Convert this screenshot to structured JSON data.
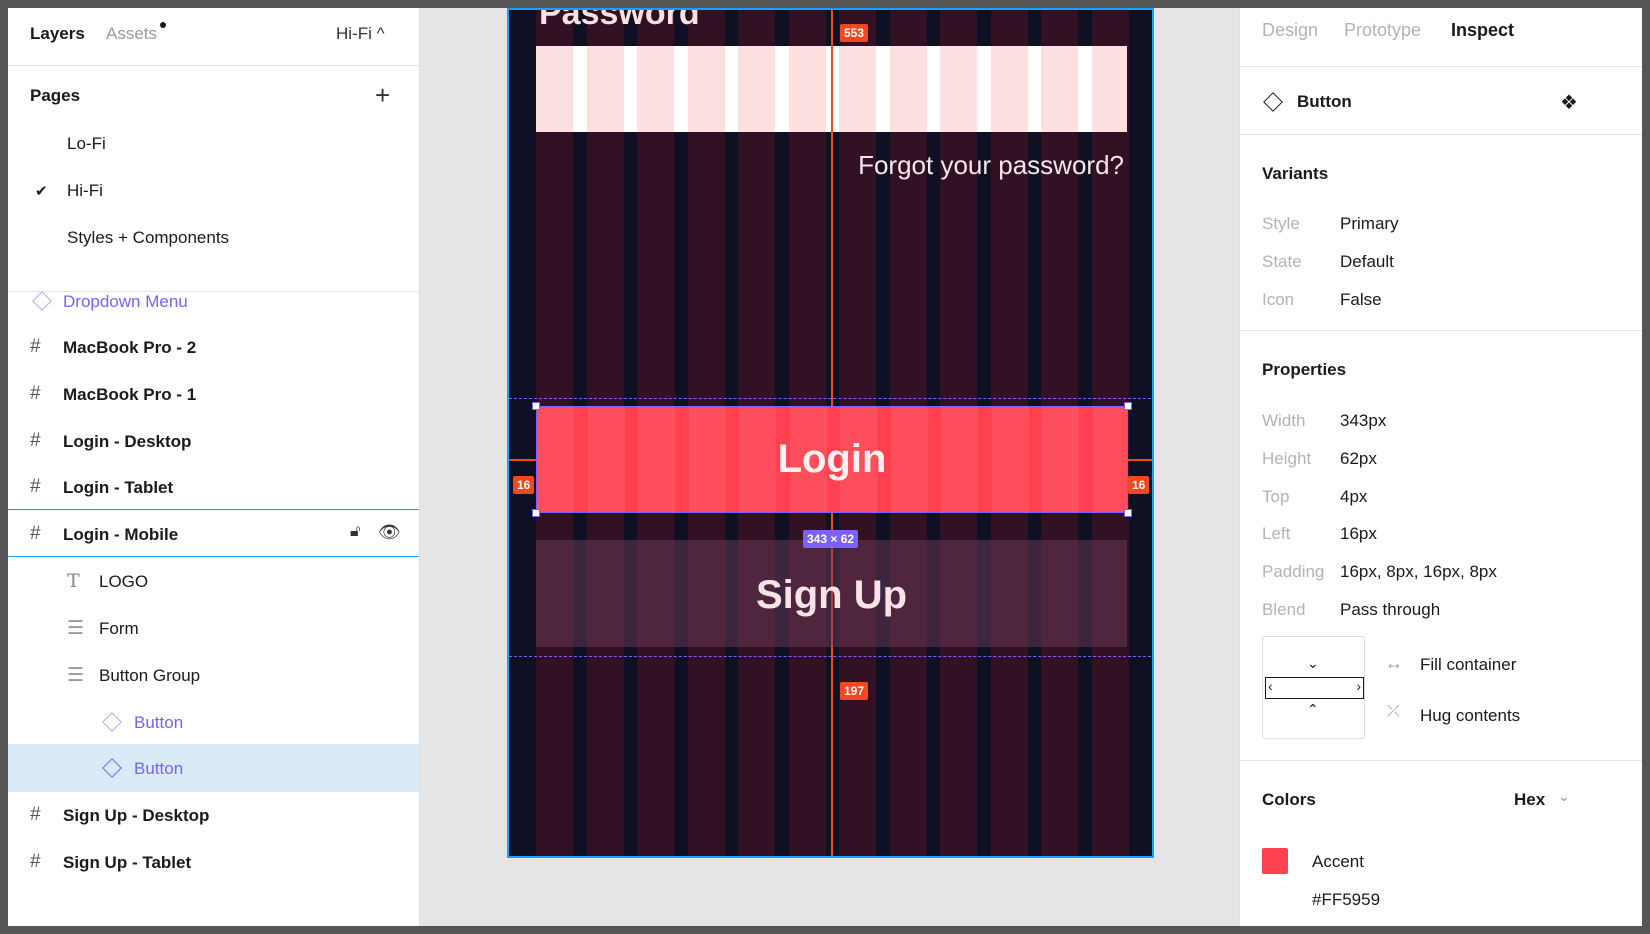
{
  "left_panel": {
    "tabs": {
      "layers": "Layers",
      "assets": "Assets",
      "page_switch": "Hi-Fi ^"
    },
    "pages_title": "Pages",
    "pages": [
      "Lo-Fi",
      "Hi-Fi",
      "Styles + Components"
    ],
    "selected_page": "Hi-Fi",
    "layers": [
      {
        "label": "Dropdown Menu",
        "type": "component"
      },
      {
        "label": "MacBook Pro - 2",
        "type": "frame"
      },
      {
        "label": "MacBook Pro - 1",
        "type": "frame"
      },
      {
        "label": "Login - Desktop",
        "type": "frame"
      },
      {
        "label": "Login - Tablet",
        "type": "frame"
      },
      {
        "label": "Login - Mobile",
        "type": "frame",
        "state": "hovered"
      },
      {
        "label": "LOGO",
        "type": "text"
      },
      {
        "label": "Form",
        "type": "group"
      },
      {
        "label": "Button Group",
        "type": "group"
      },
      {
        "label": "Button",
        "type": "instance"
      },
      {
        "label": "Button",
        "type": "instance",
        "state": "selected"
      },
      {
        "label": "Sign Up - Desktop",
        "type": "frame"
      },
      {
        "label": "Sign Up - Tablet",
        "type": "frame"
      }
    ]
  },
  "canvas": {
    "password_label": "Password",
    "forgot_link": "Forgot your password?",
    "login_button": "Login",
    "signup_button": "Sign Up",
    "measure_top": "553",
    "measure_left": "16",
    "measure_right": "16",
    "measure_bottom": "197",
    "size_badge": "343 × 62"
  },
  "right_panel": {
    "tabs": [
      "Design",
      "Prototype",
      "Inspect"
    ],
    "active_tab": "Inspect",
    "component_name": "Button",
    "variants_title": "Variants",
    "variants": [
      {
        "key": "Style",
        "value": "Primary"
      },
      {
        "key": "State",
        "value": "Default"
      },
      {
        "key": "Icon",
        "value": "False"
      }
    ],
    "properties_title": "Properties",
    "properties": [
      {
        "key": "Width",
        "value": "343px"
      },
      {
        "key": "Height",
        "value": "62px"
      },
      {
        "key": "Top",
        "value": "4px"
      },
      {
        "key": "Left",
        "value": "16px"
      },
      {
        "key": "Padding",
        "value": "16px, 8px, 16px, 8px"
      },
      {
        "key": "Blend",
        "value": "Pass through"
      }
    ],
    "resizing": {
      "horizontal": "Fill container",
      "vertical": "Hug contents"
    },
    "colors_title": "Colors",
    "color_format": "Hex",
    "colors": [
      {
        "name": "Accent",
        "hex": "#FF5959"
      }
    ]
  },
  "theme": {
    "accent": "#FF4050",
    "selection": "#7B61FF",
    "measure": "#F24822",
    "frame_outline": "#18A0FB"
  }
}
